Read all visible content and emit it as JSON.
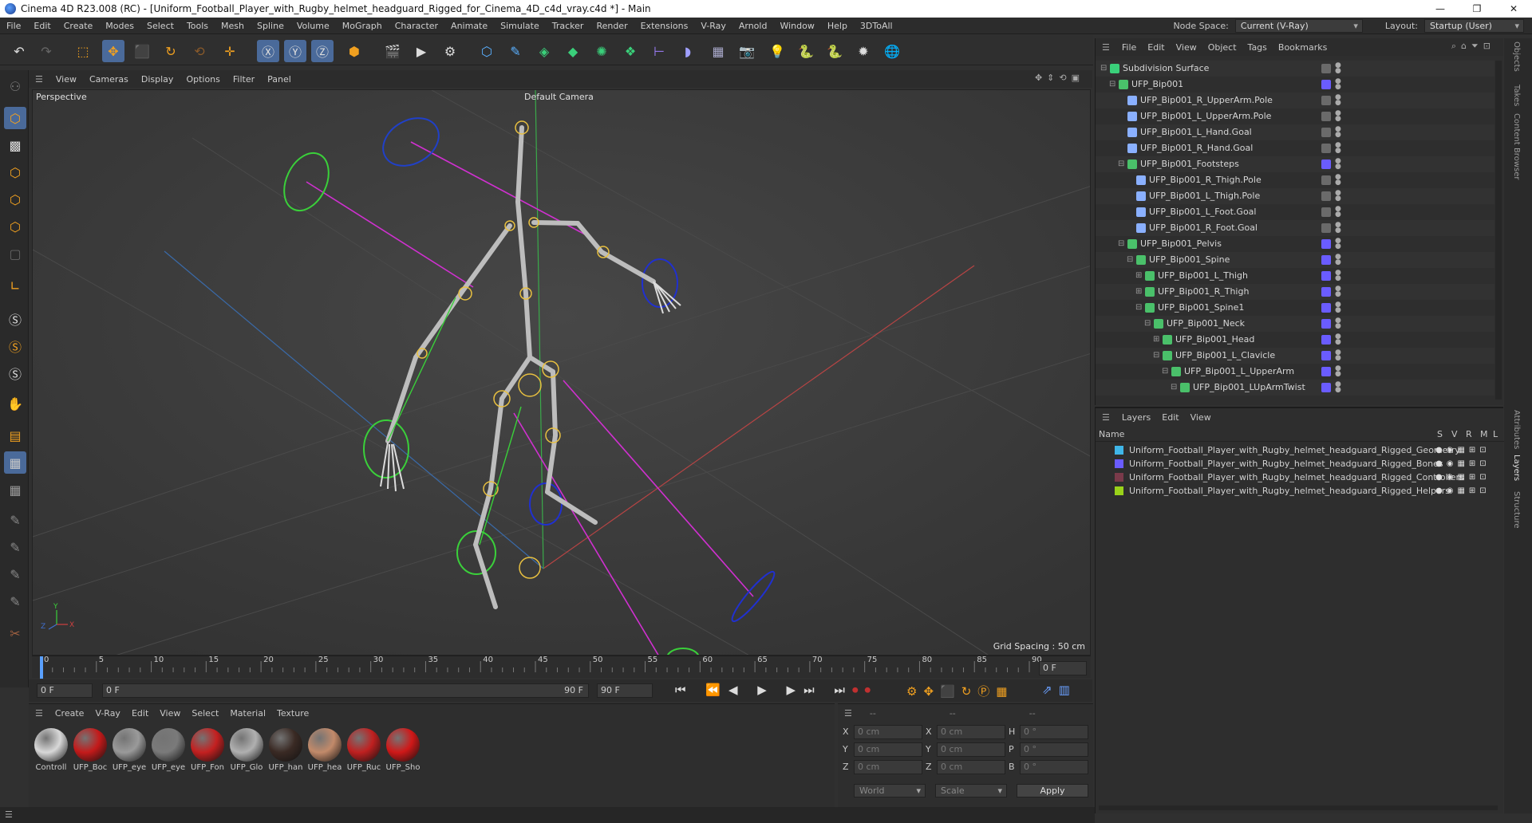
{
  "window": {
    "title": "Cinema 4D R23.008 (RC) - [Uniform_Football_Player_with_Rugby_helmet_headguard_Rigged_for_Cinema_4D_c4d_vray.c4d *] - Main",
    "controls": [
      "—",
      "❐",
      "✕"
    ]
  },
  "menubar": {
    "items": [
      "File",
      "Edit",
      "Create",
      "Modes",
      "Select",
      "Tools",
      "Mesh",
      "Spline",
      "Volume",
      "MoGraph",
      "Character",
      "Animate",
      "Simulate",
      "Tracker",
      "Render",
      "Extensions",
      "V-Ray",
      "Arnold",
      "Window",
      "Help",
      "3DToAll"
    ],
    "node_space_label": "Node Space:",
    "node_space_value": "Current (V-Ray)",
    "layout_label": "Layout:",
    "layout_value": "Startup (User)"
  },
  "viewport": {
    "menu": [
      "View",
      "Cameras",
      "Display",
      "Options",
      "Filter",
      "Panel"
    ],
    "projection": "Perspective",
    "camera": "Default Camera",
    "grid_spacing": "Grid Spacing : 50 cm"
  },
  "timeline": {
    "ticks": [
      "0",
      "5",
      "10",
      "15",
      "20",
      "25",
      "30",
      "35",
      "40",
      "45",
      "50",
      "55",
      "60",
      "65",
      "70",
      "75",
      "80",
      "85",
      "90"
    ],
    "current_frame_field": "0 F"
  },
  "transport": {
    "start_field": "0 F",
    "range_start": "0 F",
    "range_end": "90 F",
    "end_field": "90 F"
  },
  "materials": {
    "menu": [
      "Create",
      "V-Ray",
      "Edit",
      "View",
      "Select",
      "Material",
      "Texture"
    ],
    "items": [
      {
        "label": "Controll",
        "color": "#d8d8d8"
      },
      {
        "label": "UFP_Boc",
        "color": "#c41a1a"
      },
      {
        "label": "UFP_eye",
        "color": "#9a9a9a"
      },
      {
        "label": "UFP_eye",
        "color": "#7a7a7a"
      },
      {
        "label": "UFP_Fon",
        "color": "#c42020"
      },
      {
        "label": "UFP_Glo",
        "color": "#b0b0b0"
      },
      {
        "label": "UFP_han",
        "color": "#3a2a24"
      },
      {
        "label": "UFP_hea",
        "color": "#c28a6a"
      },
      {
        "label": "UFP_Ruc",
        "color": "#c02020"
      },
      {
        "label": "UFP_Sho",
        "color": "#d01818"
      }
    ]
  },
  "coords": {
    "header": [
      "--",
      "--",
      "--"
    ],
    "rows": [
      {
        "a": "X",
        "av": "0 cm",
        "b": "X",
        "bv": "0 cm",
        "c": "H",
        "cv": "0 °"
      },
      {
        "a": "Y",
        "av": "0 cm",
        "b": "Y",
        "bv": "0 cm",
        "c": "P",
        "cv": "0 °"
      },
      {
        "a": "Z",
        "av": "0 cm",
        "b": "Z",
        "bv": "0 cm",
        "c": "B",
        "cv": "0 °"
      }
    ],
    "mode": "World",
    "scale": "Scale",
    "apply": "Apply"
  },
  "object_manager": {
    "menu": [
      "File",
      "Edit",
      "View",
      "Object",
      "Tags",
      "Bookmarks"
    ],
    "rows": [
      {
        "name": "Subdivision Surface",
        "indent": 0,
        "expander": "⊟"
      },
      {
        "name": "UFP_Bip001",
        "indent": 1,
        "expander": "⊟"
      },
      {
        "name": "UFP_Bip001_R_UpperArm.Pole",
        "indent": 2,
        "expander": ""
      },
      {
        "name": "UFP_Bip001_L_UpperArm.Pole",
        "indent": 2,
        "expander": ""
      },
      {
        "name": "UFP_Bip001_L_Hand.Goal",
        "indent": 2,
        "expander": ""
      },
      {
        "name": "UFP_Bip001_R_Hand.Goal",
        "indent": 2,
        "expander": ""
      },
      {
        "name": "UFP_Bip001_Footsteps",
        "indent": 2,
        "expander": "⊟"
      },
      {
        "name": "UFP_Bip001_R_Thigh.Pole",
        "indent": 3,
        "expander": ""
      },
      {
        "name": "UFP_Bip001_L_Thigh.Pole",
        "indent": 3,
        "expander": ""
      },
      {
        "name": "UFP_Bip001_L_Foot.Goal",
        "indent": 3,
        "expander": ""
      },
      {
        "name": "UFP_Bip001_R_Foot.Goal",
        "indent": 3,
        "expander": ""
      },
      {
        "name": "UFP_Bip001_Pelvis",
        "indent": 2,
        "expander": "⊟"
      },
      {
        "name": "UFP_Bip001_Spine",
        "indent": 3,
        "expander": "⊟"
      },
      {
        "name": "UFP_Bip001_L_Thigh",
        "indent": 4,
        "expander": "⊞"
      },
      {
        "name": "UFP_Bip001_R_Thigh",
        "indent": 4,
        "expander": "⊞"
      },
      {
        "name": "UFP_Bip001_Spine1",
        "indent": 4,
        "expander": "⊟"
      },
      {
        "name": "UFP_Bip001_Neck",
        "indent": 5,
        "expander": "⊟"
      },
      {
        "name": "UFP_Bip001_Head",
        "indent": 6,
        "expander": "⊞"
      },
      {
        "name": "UFP_Bip001_L_Clavicle",
        "indent": 6,
        "expander": "⊟"
      },
      {
        "name": "UFP_Bip001_L_UpperArm",
        "indent": 7,
        "expander": "⊟"
      },
      {
        "name": "UFP_Bip001_LUpArmTwist",
        "indent": 8,
        "expander": "⊟"
      }
    ]
  },
  "layer_manager": {
    "menu": [
      "Layers",
      "Edit",
      "View"
    ],
    "columns": [
      "Name",
      "S",
      "V",
      "R",
      "M",
      "L"
    ],
    "rows": [
      {
        "name": "Uniform_Football_Player_with_Rugby_helmet_headguard_Rigged_Geometry",
        "color": "#3fb6e8"
      },
      {
        "name": "Uniform_Football_Player_with_Rugby_helmet_headguard_Rigged_Bones",
        "color": "#6a5cff"
      },
      {
        "name": "Uniform_Football_Player_with_Rugby_helmet_headguard_Rigged_Controllers",
        "color": "#7a3a4a"
      },
      {
        "name": "Uniform_Football_Player_with_Rugby_helmet_headguard_Rigged_Helpers",
        "color": "#9ad21a"
      }
    ]
  },
  "right_tabs": [
    "Objects",
    "Takes",
    "Content Browser",
    "Attributes",
    "Layers",
    "Structure"
  ]
}
